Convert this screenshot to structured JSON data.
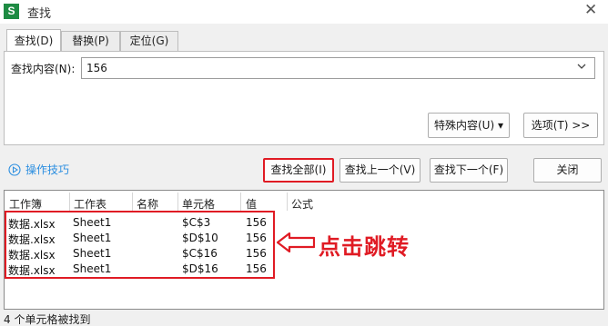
{
  "window": {
    "title": "查找",
    "app_icon_letter": "S",
    "close_glyph": "✕"
  },
  "tabs": [
    {
      "label": "查找(D)",
      "active": true
    },
    {
      "label": "替换(P)",
      "active": false
    },
    {
      "label": "定位(G)",
      "active": false
    }
  ],
  "find": {
    "label": "查找内容(N):",
    "value": "156"
  },
  "buttons": {
    "special": "特殊内容(U) ▾",
    "options": "选项(T) >>",
    "find_all": "查找全部(I)",
    "find_prev": "查找上一个(V)",
    "find_next": "查找下一个(F)",
    "close": "关闭"
  },
  "tips": {
    "label": "操作技巧"
  },
  "results": {
    "columns": [
      "工作簿",
      "工作表",
      "名称",
      "单元格",
      "值",
      "公式"
    ],
    "rows": [
      {
        "workbook": "数据.xlsx",
        "sheet": "Sheet1",
        "name": "",
        "cell": "$C$3",
        "value": "156",
        "formula": ""
      },
      {
        "workbook": "数据.xlsx",
        "sheet": "Sheet1",
        "name": "",
        "cell": "$D$10",
        "value": "156",
        "formula": ""
      },
      {
        "workbook": "数据.xlsx",
        "sheet": "Sheet1",
        "name": "",
        "cell": "$C$16",
        "value": "156",
        "formula": ""
      },
      {
        "workbook": "数据.xlsx",
        "sheet": "Sheet1",
        "name": "",
        "cell": "$D$16",
        "value": "156",
        "formula": ""
      }
    ]
  },
  "annotation": {
    "text": "点击跳转",
    "color": "#e01b24"
  },
  "status": {
    "text": "4 个单元格被找到"
  },
  "colors": {
    "accent_link": "#2b8ee0",
    "highlight_red": "#e01b24",
    "app_green": "#1e8b43"
  }
}
